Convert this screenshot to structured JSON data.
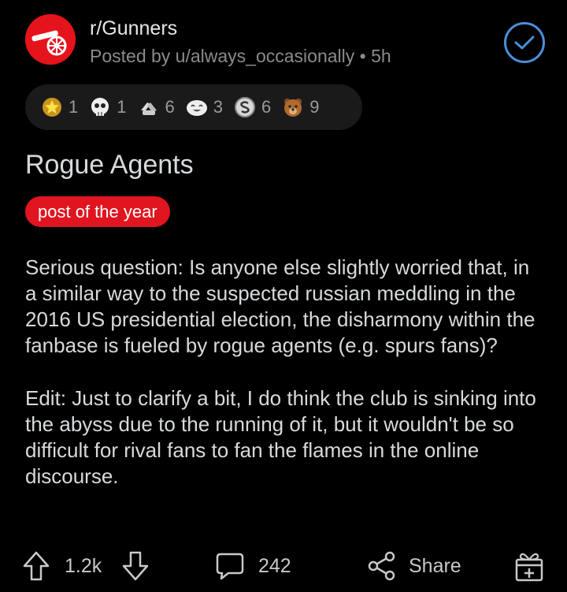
{
  "header": {
    "subreddit": "r/Gunners",
    "meta": "Posted by u/always_occasionally • 5h"
  },
  "awards": [
    {
      "icon": "gold-star-award-icon",
      "count": "1",
      "color": "#f5c518"
    },
    {
      "icon": "skull-award-icon",
      "count": "1",
      "color": "#e8e8e8"
    },
    {
      "icon": "hands-award-icon",
      "count": "6",
      "color": "#d9d9d9"
    },
    {
      "icon": "laughing-face-award-icon",
      "count": "3",
      "color": "#e8e8e8"
    },
    {
      "icon": "silver-s-award-icon",
      "count": "6",
      "color": "#bfbfbf"
    },
    {
      "icon": "bear-award-icon",
      "count": "9",
      "color": "#b06a2e"
    }
  ],
  "post": {
    "title": "Rogue Agents",
    "flair": "post of the year",
    "paragraph1": "Serious question: Is anyone else slightly worried that, in a similar way to the suspected russian meddling in the 2016 US presidential election, the disharmony within the fanbase is fueled by rogue agents (e.g. spurs fans)?",
    "paragraph2": "Edit: Just to clarify a bit, I do think the club is sinking into the abyss due to the running of it, but it wouldn't be so difficult for rival fans to fan the flames in the online discourse."
  },
  "actions": {
    "votes": "1.2k",
    "comments": "242",
    "share": "Share"
  },
  "colors": {
    "accent": "#e0151f",
    "verified": "#4a90d9",
    "background": "#000000"
  }
}
